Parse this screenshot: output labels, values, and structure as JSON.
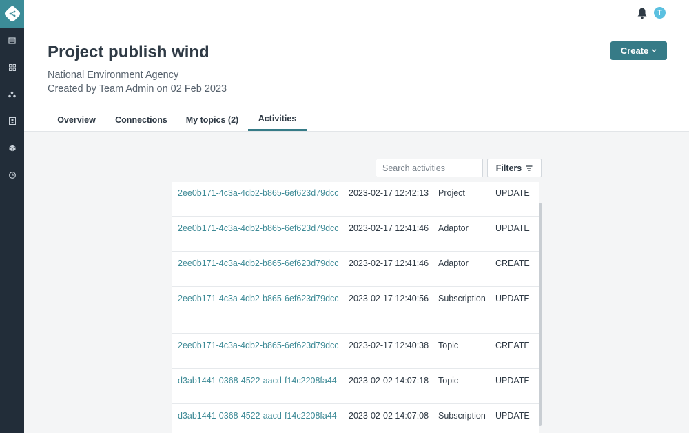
{
  "sidebar": {
    "logo_icon": "share-logo-icon",
    "items": [
      {
        "icon": "document-icon"
      },
      {
        "icon": "grid-icon"
      },
      {
        "icon": "network-icon"
      },
      {
        "icon": "contact-card-icon"
      },
      {
        "icon": "cube-icon"
      },
      {
        "icon": "clock-icon"
      }
    ]
  },
  "header": {
    "title": "Project publish wind",
    "organization": "National Environment Agency",
    "created": "Created by Team Admin on 02 Feb 2023",
    "avatar_initial": "T",
    "create_label": "Create"
  },
  "tabs": [
    {
      "label": "Overview",
      "active": false
    },
    {
      "label": "Connections",
      "active": false
    },
    {
      "label": "My topics (2)",
      "active": false
    },
    {
      "label": "Activities",
      "active": true
    }
  ],
  "toolbar": {
    "search_placeholder": "Search activities",
    "filters_label": "Filters"
  },
  "activities": [
    {
      "id": "2ee0b171-4c3a-4db2-b865-6ef623d79dcc",
      "date": "2023-02-17 12:42:13",
      "type": "Project",
      "action": "UPDATE"
    },
    {
      "id": "2ee0b171-4c3a-4db2-b865-6ef623d79dcc",
      "date": "2023-02-17 12:41:46",
      "type": "Adaptor",
      "action": "UPDATE"
    },
    {
      "id": "2ee0b171-4c3a-4db2-b865-6ef623d79dcc",
      "date": "2023-02-17 12:41:46",
      "type": "Adaptor",
      "action": "CREATE"
    },
    {
      "id": "2ee0b171-4c3a-4db2-b865-6ef623d79dcc",
      "date": "2023-02-17 12:40:56",
      "type": "Subscription",
      "action": "UPDATE"
    },
    {
      "id": "2ee0b171-4c3a-4db2-b865-6ef623d79dcc",
      "date": "2023-02-17 12:40:38",
      "type": "Topic",
      "action": "CREATE"
    },
    {
      "id": "d3ab1441-0368-4522-aacd-f14c2208fa44",
      "date": "2023-02-02 14:07:18",
      "type": "Topic",
      "action": "UPDATE"
    },
    {
      "id": "d3ab1441-0368-4522-aacd-f14c2208fa44",
      "date": "2023-02-02 14:07:08",
      "type": "Subscription",
      "action": "UPDATE"
    }
  ],
  "colors": {
    "accent": "#367b87",
    "link": "#3d8a96",
    "sidebar": "#222d39"
  }
}
